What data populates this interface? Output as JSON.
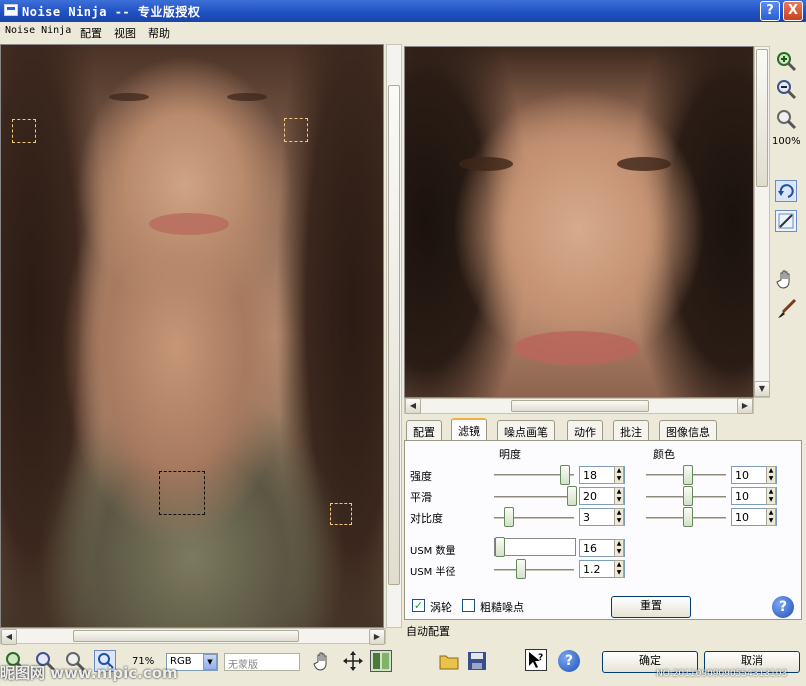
{
  "window": {
    "title": "Noise Ninja -- 专业版授权",
    "help_glyph": "?",
    "close_glyph": "X"
  },
  "menu": [
    "Noise Ninja",
    "配置",
    "视图",
    "帮助"
  ],
  "right_toolbar": {
    "zoom_level": "100%"
  },
  "tabs": [
    "配置",
    "滤镜",
    "噪点画笔",
    "动作",
    "批注",
    "图像信息"
  ],
  "filter": {
    "col_brightness": "明度",
    "col_color": "颜色",
    "rows": [
      {
        "label": "强度",
        "brightness": "18",
        "color": "10"
      },
      {
        "label": "平滑",
        "brightness": "20",
        "color": "10"
      },
      {
        "label": "对比度",
        "brightness": "3",
        "color": "10"
      }
    ],
    "usm_amount_label": "USM 数量",
    "usm_amount": "16",
    "usm_radius_label": "USM 半径",
    "usm_radius": "1.2",
    "checkbox_vortex": "涡轮",
    "checkbox_vortex_checked": true,
    "checkbox_coarse": "粗糙噪点",
    "checkbox_coarse_checked": false,
    "reset_label": "重置"
  },
  "status_text": "自动配置",
  "bottom": {
    "zoom": "71%",
    "color_mode": "RGB",
    "profile": "无蒙版",
    "ok_label": "确定",
    "cancel_label": "取消"
  },
  "watermark": {
    "site": "昵图网 www.nipic.com",
    "id": "NO:20110909090554313103"
  },
  "colors": {
    "titlebar": "#245edb",
    "accent": "#f4b03c",
    "dialog": "#ece9d8"
  }
}
